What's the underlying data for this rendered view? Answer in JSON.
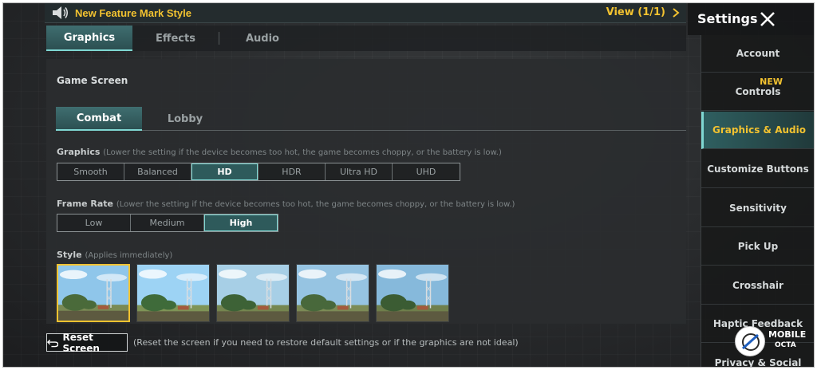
{
  "notice": {
    "title": "New Feature Mark Style",
    "view_label": "View (1/1)",
    "icon": "speaker-icon"
  },
  "tabs": [
    {
      "label": "Graphics",
      "active": true
    },
    {
      "label": "Effects",
      "active": false
    },
    {
      "label": "Audio",
      "active": false
    }
  ],
  "game_screen": {
    "title": "Game Screen",
    "subtabs": [
      {
        "label": "Combat",
        "active": true
      },
      {
        "label": "Lobby",
        "active": false
      }
    ]
  },
  "graphics": {
    "label": "Graphics",
    "hint": "(Lower the setting if the device becomes too hot, the game becomes choppy, or the battery is low.)",
    "options": [
      "Smooth",
      "Balanced",
      "HD",
      "HDR",
      "Ultra HD",
      "UHD"
    ],
    "selected": "HD"
  },
  "frame_rate": {
    "label": "Frame Rate",
    "hint": "(Lower the setting if the device becomes too hot, the game becomes choppy, or the battery is low.)",
    "options": [
      "Low",
      "Medium",
      "High"
    ],
    "selected": "High"
  },
  "style": {
    "label": "Style",
    "hint": "(Applies immediately)",
    "thumbnails": 5,
    "selected_index": 0
  },
  "reset": {
    "label": "Reset Screen",
    "hint": "(Reset the screen if you need to restore default settings or if the graphics are not ideal)"
  },
  "sidebar": {
    "title": "Settings",
    "items": [
      {
        "label": "Account",
        "active": false
      },
      {
        "label": "Controls",
        "active": false,
        "badge": "NEW"
      },
      {
        "label": "Graphics & Audio",
        "active": true
      },
      {
        "label": "Customize Buttons",
        "active": false
      },
      {
        "label": "Sensitivity",
        "active": false
      },
      {
        "label": "Pick Up",
        "active": false
      },
      {
        "label": "Crosshair",
        "active": false
      },
      {
        "label": "Haptic Feedback",
        "active": false
      },
      {
        "label": "Privacy & Social",
        "active": false
      }
    ]
  },
  "watermark": {
    "line1": "MOBILE",
    "line2": "OCTA"
  },
  "colors": {
    "accent_yellow": "#f2c230",
    "accent_teal": "#7fd7d2",
    "active_bg": "#2e5a5b"
  }
}
